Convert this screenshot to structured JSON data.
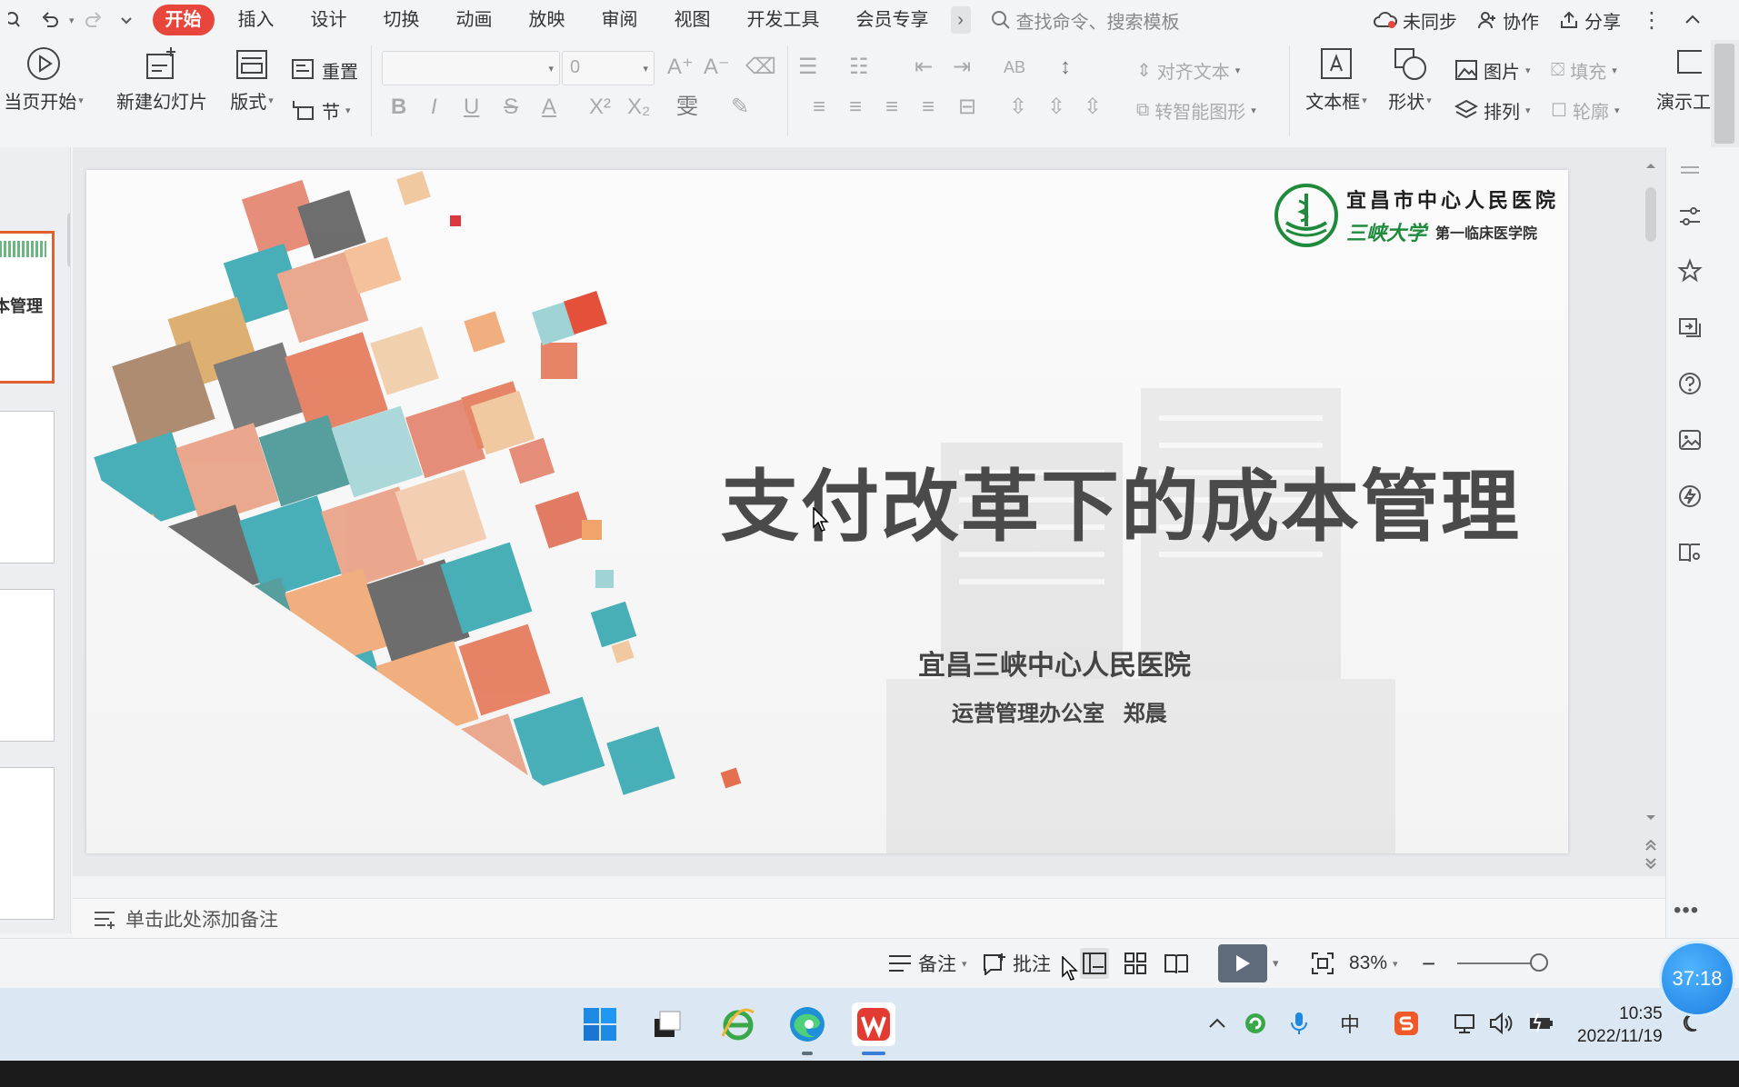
{
  "menubar": {
    "tabs": [
      "开始",
      "插入",
      "设计",
      "切换",
      "动画",
      "放映",
      "审阅",
      "视图",
      "开发工具",
      "会员专享"
    ],
    "active_tab": "开始",
    "search_placeholder": "查找命令、搜索模板",
    "sync_label": "未同步",
    "collab_label": "协作",
    "share_label": "分享"
  },
  "ribbon": {
    "from_current": "当页开始",
    "new_slide": "新建幻灯片",
    "layout": "版式",
    "reset": "重置",
    "section": "节",
    "font_size": "0",
    "align_text": "对齐文本",
    "smart_shape": "转智能图形",
    "text_box": "文本框",
    "shape": "形状",
    "picture": "图片",
    "arrange": "排列",
    "fill": "填充",
    "outline": "轮廓",
    "present": "演示工"
  },
  "thumbnails": {
    "first_title": "本管理"
  },
  "slide": {
    "logo_line1": "宜昌市中心人民医院",
    "logo_calligraphy": "三峡大学",
    "logo_subtitle": "第一临床医学院",
    "title": "支付改革下的成本管理",
    "subtitle1": "宜昌三峡中心人民医院",
    "subtitle2": "运营管理办公室 郑晨"
  },
  "notes": {
    "placeholder": "单击此处添加备注"
  },
  "status": {
    "notes_label": "备注",
    "comment_label": "批注",
    "zoom": "83%"
  },
  "timer": "37:18",
  "taskbar": {
    "ime": "中",
    "time": "10:35",
    "date": "2022/11/19"
  },
  "colors": {
    "accent": "#e8453c",
    "selected_thumb": "#e1602f",
    "brand_green": "#1f8a3c"
  }
}
